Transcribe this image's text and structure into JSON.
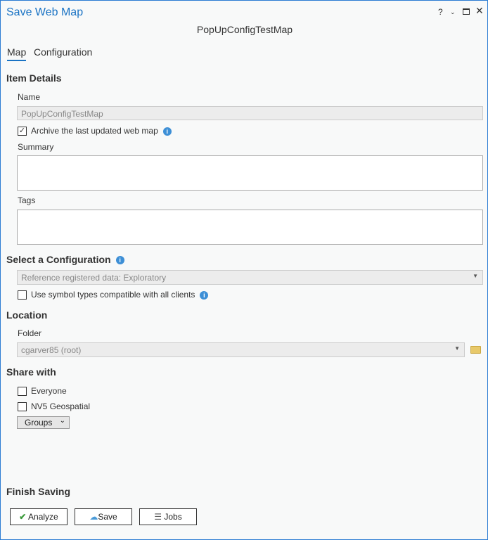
{
  "window": {
    "title": "Save Web Map",
    "help": "?",
    "subtitle": "PopUpConfigTestMap"
  },
  "tabs": [
    {
      "label": "Map"
    },
    {
      "label": "Configuration"
    }
  ],
  "item_details": {
    "heading": "Item Details",
    "name_label": "Name",
    "name_value": "PopUpConfigTestMap",
    "archive_label": "Archive the last updated web map",
    "archive_checked": true,
    "summary_label": "Summary",
    "summary_value": "",
    "tags_label": "Tags",
    "tags_value": ""
  },
  "configuration": {
    "heading": "Select a Configuration",
    "selected": "Reference registered data: Exploratory",
    "symbol_label": "Use symbol types compatible with all clients"
  },
  "location": {
    "heading": "Location",
    "folder_label": "Folder",
    "folder_value": "cgarver85 (root)"
  },
  "share": {
    "heading": "Share with",
    "everyone": "Everyone",
    "org": "NV5 Geospatial",
    "groups": "Groups"
  },
  "finish": {
    "heading": "Finish Saving",
    "analyze": "Analyze",
    "save": "Save",
    "jobs": "Jobs"
  },
  "colors": {
    "accent": "#1a73c4",
    "check": "#3a9a3a"
  }
}
